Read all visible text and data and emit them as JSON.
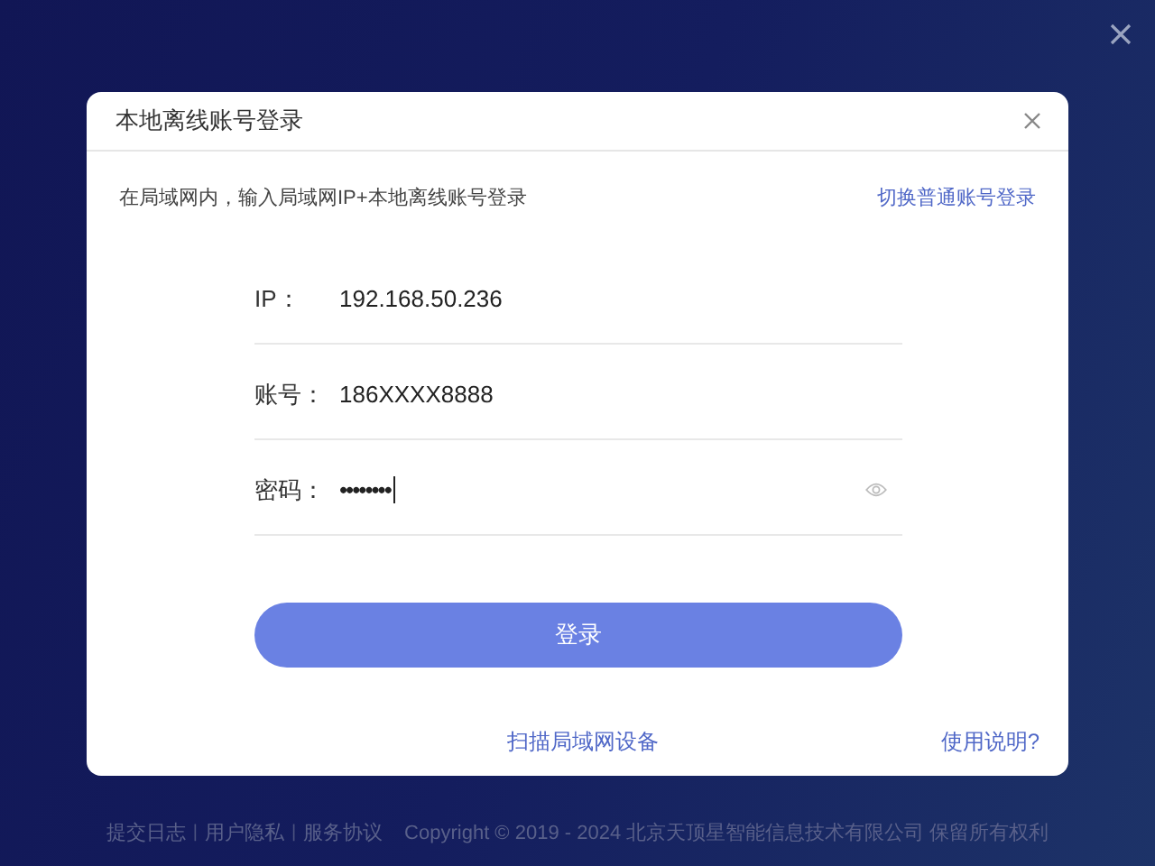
{
  "dialog": {
    "title": "本地离线账号登录",
    "hint": "在局域网内，输入局域网IP+本地离线账号登录",
    "switch_link": "切换普通账号登录",
    "fields": [
      {
        "label": "IP：",
        "value": "192.168.50.236",
        "kind": "text",
        "focused": false
      },
      {
        "label": "账号：",
        "value": "186XXXX8888",
        "kind": "text",
        "focused": false
      },
      {
        "label": "密码：",
        "value": "••••••••",
        "kind": "password",
        "focused": true
      }
    ],
    "login_button": "登录",
    "scan_link": "扫描局域网设备",
    "help_link": "使用说明?"
  },
  "footer": {
    "items": [
      {
        "kind": "link",
        "text": "提交日志"
      },
      {
        "kind": "separator",
        "text": "|"
      },
      {
        "kind": "link",
        "text": "用户隐私"
      },
      {
        "kind": "separator",
        "text": "|"
      },
      {
        "kind": "link",
        "text": "服务协议"
      }
    ],
    "copyright": "Copyright © 2019 - 2024 北京天顶星智能信息技术有限公司 保留所有权利"
  }
}
